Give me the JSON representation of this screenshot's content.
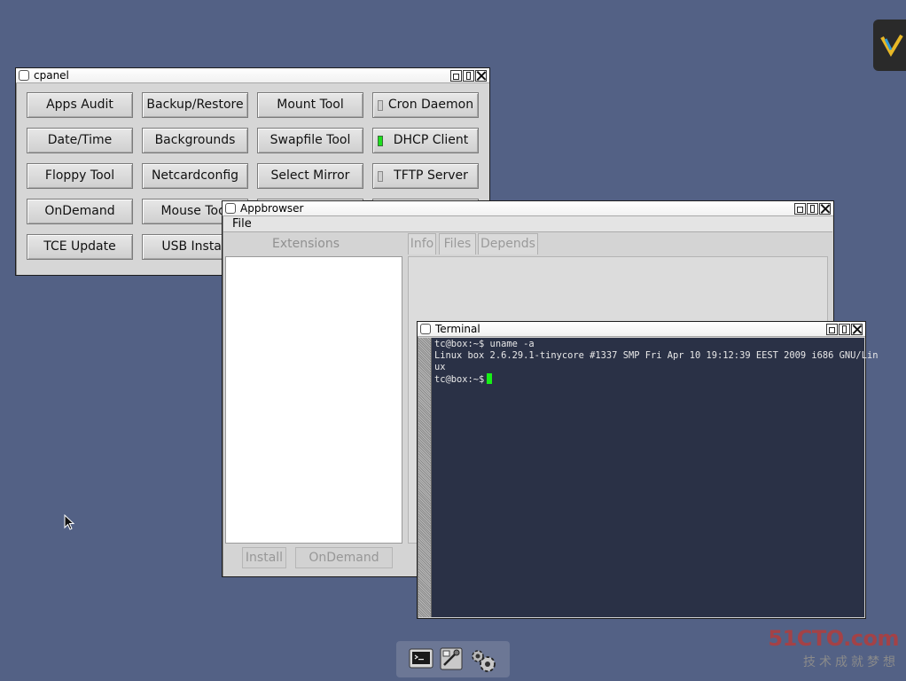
{
  "cpanel": {
    "title": "cpanel",
    "buttons": [
      "Apps Audit",
      "Backup/Restore",
      "Mount Tool",
      "Cron Daemon",
      "Date/Time",
      "Backgrounds",
      "Swapfile Tool",
      "DHCP Client",
      "Floppy Tool",
      "Netcardconfig",
      "Select Mirror",
      "TFTP Server",
      "OnDemand",
      "Mouse Tool",
      "",
      "",
      "TCE Update",
      "USB Install",
      "",
      ""
    ],
    "services": {
      "cron_daemon": {
        "label": "Cron Daemon",
        "running": false
      },
      "dhcp_client": {
        "label": "DHCP Client",
        "running": true,
        "indicator_color": "#1ee01e"
      },
      "tftp_server": {
        "label": "TFTP Server",
        "running": false
      }
    }
  },
  "appbrowser": {
    "title": "Appbrowser",
    "menu_file": "File",
    "extensions_label": "Extensions",
    "tabs": [
      "Info",
      "Files",
      "Depends"
    ],
    "install_label": "Install",
    "ondemand_label": "OnDemand"
  },
  "terminal": {
    "title": "Terminal",
    "lines": [
      "tc@box:~$ uname -a",
      "Linux box 2.6.29.1-tinycore #1337 SMP Fri Apr 10 19:12:39 EEST 2009 i686 GNU/Lin",
      "ux",
      "tc@box:~$"
    ]
  },
  "dock": {
    "icons": [
      "terminal-icon",
      "control-panel-icon",
      "settings-gears-icon"
    ]
  },
  "watermark": {
    "site": "51CTO.com",
    "slogan": "技术成就梦想"
  },
  "colors": {
    "desktop": "#536185",
    "terminal_bg": "#2a3146",
    "cursor": "#17f017"
  }
}
